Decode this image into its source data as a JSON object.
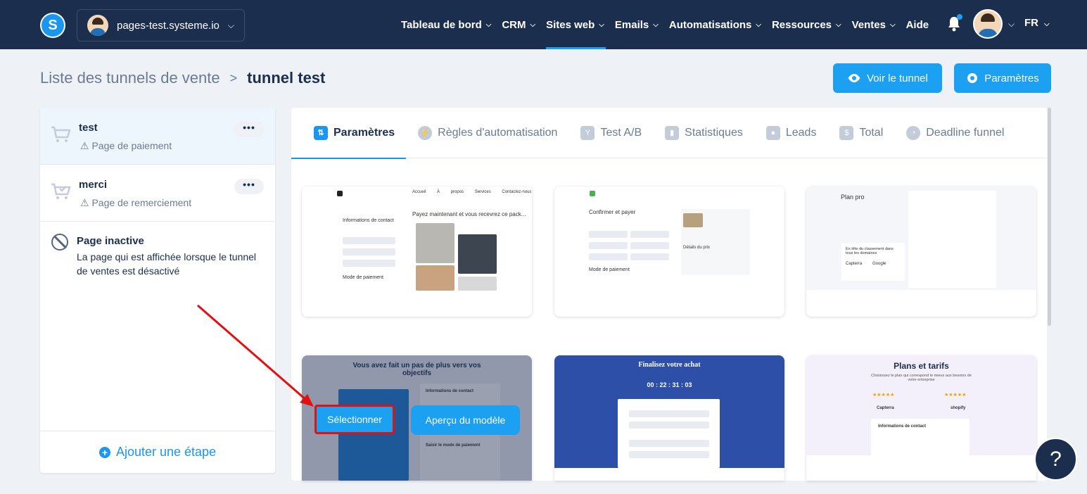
{
  "topbar": {
    "logo_letter": "S",
    "site": "pages-test.systeme.io",
    "nav": [
      {
        "label": "Tableau de bord",
        "chevron": true
      },
      {
        "label": "CRM",
        "chevron": true
      },
      {
        "label": "Sites web",
        "chevron": true,
        "active": true
      },
      {
        "label": "Emails",
        "chevron": true
      },
      {
        "label": "Automatisations",
        "chevron": true
      },
      {
        "label": "Ressources",
        "chevron": true
      },
      {
        "label": "Ventes",
        "chevron": true
      },
      {
        "label": "Aide",
        "chevron": false
      }
    ],
    "lang": "FR"
  },
  "breadcrumb": {
    "parent": "Liste des tunnels de vente",
    "separator": ">",
    "current": "tunnel test"
  },
  "actions": {
    "view": "Voir le tunnel",
    "settings": "Paramètres"
  },
  "sidebar": {
    "steps": [
      {
        "title": "test",
        "subtitle": "Page de paiement",
        "menu": "•••"
      },
      {
        "title": "merci",
        "subtitle": "Page de remerciement",
        "menu": "•••"
      }
    ],
    "inactive": {
      "title": "Page inactive",
      "description": "La page qui est affichée lorsque le tunnel de ventes est désactivé"
    },
    "add_step": "Ajouter une étape"
  },
  "tabs": [
    "Paramètres",
    "Règles d'automatisation",
    "Test A/B",
    "Statistiques",
    "Leads",
    "Total",
    "Deadline funnel"
  ],
  "templates": {
    "t1": {
      "nav": [
        "Accueil",
        "À propos",
        "Services",
        "Contactez-nous"
      ],
      "heading": "Payez maintenant et vous recevrez ce pack...",
      "contact": "Informations de contact",
      "payment": "Mode de paiement"
    },
    "t2": {
      "heading": "Confirmer et payer",
      "details": "Détails du prix",
      "payment": "Mode de paiement"
    },
    "t3": {
      "heading": "Plan pro",
      "rank": "En tête du classement dans tous les domaines",
      "brands": [
        "Capterra",
        "Google"
      ]
    },
    "t4": {
      "heading": "Vous avez fait un pas de plus vers vos objectifs",
      "contact": "Informations de contact",
      "select": "Sélectionner",
      "preview": "Aperçu du modèle",
      "payment": "Saisir le mode de paiement"
    },
    "t5": {
      "heading": "Finalisez votre achat",
      "timer": "00 : 22 : 31 : 03"
    },
    "t6": {
      "heading": "Plans et tarifs",
      "sub": "Choisissez le plan qui correspond le mieux aux besoins de votre entreprise",
      "brands": [
        "Capterra",
        "shopify"
      ],
      "contact": "Informations de contact"
    }
  },
  "help": "?"
}
